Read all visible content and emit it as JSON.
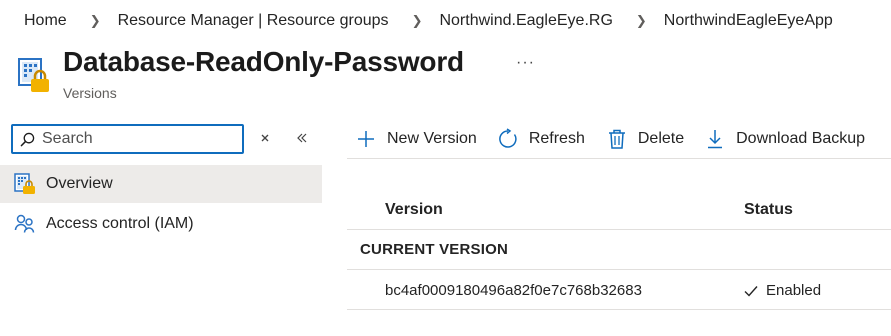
{
  "breadcrumb": {
    "items": [
      "Home",
      "Resource Manager | Resource groups",
      "Northwind.EagleEye.RG",
      "NorthwindEagleEyeApp"
    ]
  },
  "header": {
    "icon": "key-vault-secret-icon",
    "title": "Database-ReadOnly-Password",
    "subtitle": "Versions",
    "more_label": "···"
  },
  "sidebar": {
    "search": {
      "value": "",
      "placeholder": "Search"
    },
    "items": [
      {
        "label": "Overview",
        "icon": "secret-icon",
        "active": true
      },
      {
        "label": "Access control (IAM)",
        "icon": "people-icon",
        "active": false
      }
    ]
  },
  "toolbar": {
    "new_version": "New Version",
    "refresh": "Refresh",
    "delete": "Delete",
    "download_backup": "Download Backup"
  },
  "table": {
    "columns": [
      "Version",
      "Status"
    ],
    "group_label": "CURRENT VERSION",
    "rows": [
      {
        "version": "bc4af0009180496a82f0e7c768b32683",
        "status": "Enabled"
      }
    ]
  },
  "colors": {
    "accent": "#0f6cbd",
    "secret_yellow": "#f2b200",
    "active_nav_bg": "#edebe9",
    "divider": "#e1dfdd"
  }
}
